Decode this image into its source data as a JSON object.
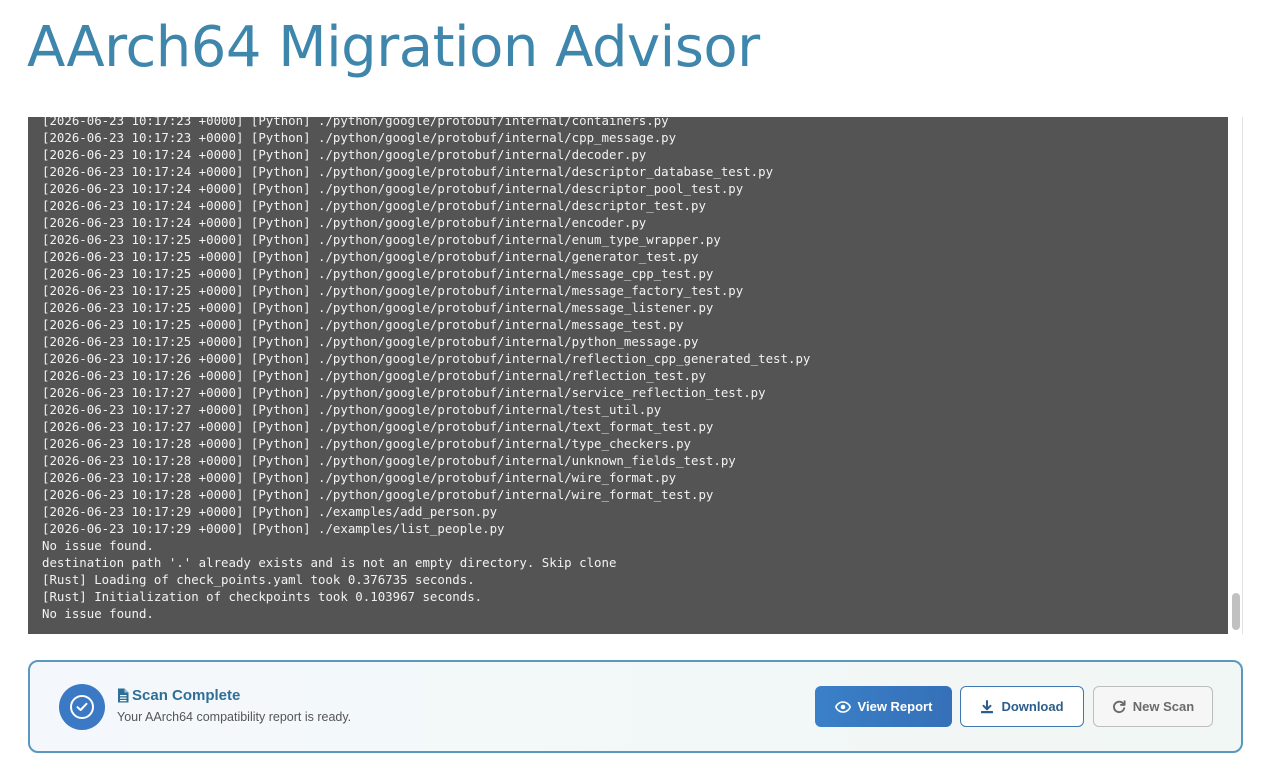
{
  "app": {
    "title": "AArch64 Migration Advisor"
  },
  "log": {
    "lines": [
      "[2026-06-23 10:17:23 +0000] [Python] ./python/google/protobuf/internal/containers.py",
      "[2026-06-23 10:17:23 +0000] [Python] ./python/google/protobuf/internal/cpp_message.py",
      "[2026-06-23 10:17:24 +0000] [Python] ./python/google/protobuf/internal/decoder.py",
      "[2026-06-23 10:17:24 +0000] [Python] ./python/google/protobuf/internal/descriptor_database_test.py",
      "[2026-06-23 10:17:24 +0000] [Python] ./python/google/protobuf/internal/descriptor_pool_test.py",
      "[2026-06-23 10:17:24 +0000] [Python] ./python/google/protobuf/internal/descriptor_test.py",
      "[2026-06-23 10:17:24 +0000] [Python] ./python/google/protobuf/internal/encoder.py",
      "[2026-06-23 10:17:25 +0000] [Python] ./python/google/protobuf/internal/enum_type_wrapper.py",
      "[2026-06-23 10:17:25 +0000] [Python] ./python/google/protobuf/internal/generator_test.py",
      "[2026-06-23 10:17:25 +0000] [Python] ./python/google/protobuf/internal/message_cpp_test.py",
      "[2026-06-23 10:17:25 +0000] [Python] ./python/google/protobuf/internal/message_factory_test.py",
      "[2026-06-23 10:17:25 +0000] [Python] ./python/google/protobuf/internal/message_listener.py",
      "[2026-06-23 10:17:25 +0000] [Python] ./python/google/protobuf/internal/message_test.py",
      "[2026-06-23 10:17:25 +0000] [Python] ./python/google/protobuf/internal/python_message.py",
      "[2026-06-23 10:17:26 +0000] [Python] ./python/google/protobuf/internal/reflection_cpp_generated_test.py",
      "[2026-06-23 10:17:26 +0000] [Python] ./python/google/protobuf/internal/reflection_test.py",
      "[2026-06-23 10:17:27 +0000] [Python] ./python/google/protobuf/internal/service_reflection_test.py",
      "[2026-06-23 10:17:27 +0000] [Python] ./python/google/protobuf/internal/test_util.py",
      "[2026-06-23 10:17:27 +0000] [Python] ./python/google/protobuf/internal/text_format_test.py",
      "[2026-06-23 10:17:28 +0000] [Python] ./python/google/protobuf/internal/type_checkers.py",
      "[2026-06-23 10:17:28 +0000] [Python] ./python/google/protobuf/internal/unknown_fields_test.py",
      "[2026-06-23 10:17:28 +0000] [Python] ./python/google/protobuf/internal/wire_format.py",
      "[2026-06-23 10:17:28 +0000] [Python] ./python/google/protobuf/internal/wire_format_test.py",
      "[2026-06-23 10:17:29 +0000] [Python] ./examples/add_person.py",
      "[2026-06-23 10:17:29 +0000] [Python] ./examples/list_people.py",
      "No issue found.",
      "destination path '.' already exists and is not an empty directory. Skip clone",
      "[Rust] Loading of check_points.yaml took 0.376735 seconds.",
      "[Rust] Initialization of checkpoints took 0.103967 seconds.",
      "No issue found."
    ]
  },
  "status": {
    "title": "Scan Complete",
    "subtitle": "Your AArch64 compatibility report is ready.",
    "icon": "check-circle-icon"
  },
  "actions": {
    "view_report": "View Report",
    "download": "Download",
    "new_scan": "New Scan"
  },
  "colors": {
    "title": "#3f86ad",
    "log_background": "#545454",
    "accent": "#3b79c4",
    "card_border": "#5a98bf"
  }
}
